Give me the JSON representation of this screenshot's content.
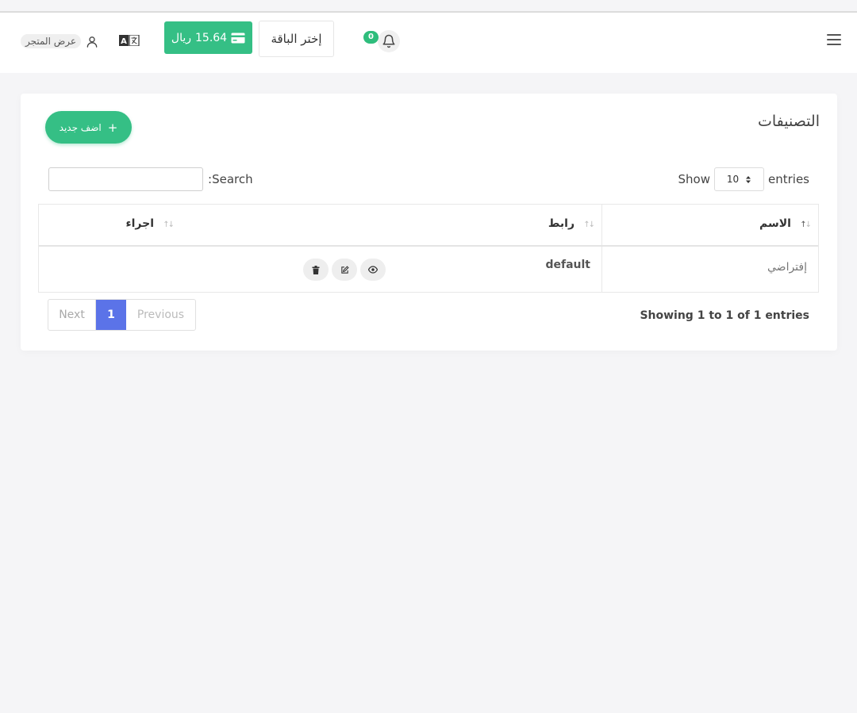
{
  "header": {
    "notification_count": "0",
    "plan_button_label": "إختر الباقة",
    "balance_amount": "15.64",
    "balance_currency": "ريال",
    "store_link_label": "عرض المتجر"
  },
  "page": {
    "title": "التصنيفات",
    "add_button_label": "اضف جديد"
  },
  "table_controls": {
    "show_label": "Show",
    "entries_label": "entries",
    "page_size": "10",
    "search_label": "Search:"
  },
  "table": {
    "columns": [
      "الاسم",
      "رابط",
      "اجراء"
    ],
    "rows": [
      {
        "name": "إفتراضي",
        "link": "default"
      }
    ]
  },
  "pagination": {
    "next_label": "Next",
    "current_page": "1",
    "previous_label": "Previous",
    "summary": "Showing 1 to 1 of 1 entries"
  },
  "colors": {
    "accent_green": "#35bf85",
    "active_page_blue": "#5b73e8"
  }
}
